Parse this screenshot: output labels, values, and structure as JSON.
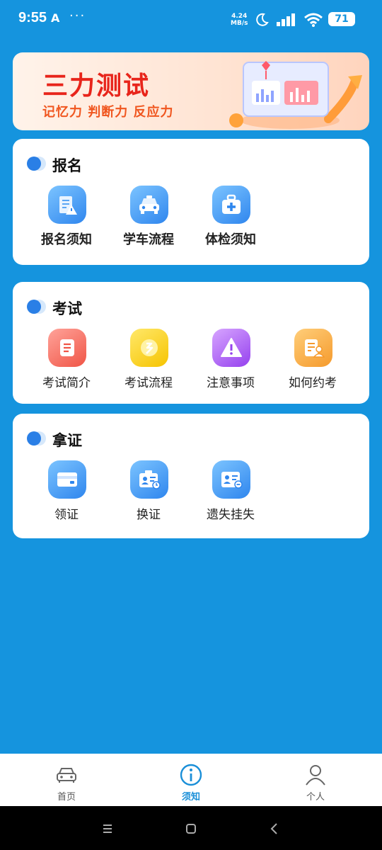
{
  "status_bar": {
    "time": "9:55",
    "app_indicator": "A",
    "more": "···",
    "speed_value": "4.24",
    "speed_unit": "MB/s",
    "battery": "71"
  },
  "banner": {
    "title": "三力测试",
    "subtitle": "记忆力 判断力 反应力"
  },
  "sections": {
    "signup": {
      "title": "报名",
      "items": [
        {
          "label": "报名须知",
          "icon": "document-warning-icon"
        },
        {
          "label": "学车流程",
          "icon": "car-icon"
        },
        {
          "label": "体检须知",
          "icon": "medical-kit-icon"
        }
      ]
    },
    "exam": {
      "title": "考试",
      "items": [
        {
          "label": "考试简介",
          "icon": "document-icon"
        },
        {
          "label": "考试流程",
          "icon": "flow-icon"
        },
        {
          "label": "注意事项",
          "icon": "warning-icon"
        },
        {
          "label": "如何约考",
          "icon": "appointment-icon"
        }
      ]
    },
    "license": {
      "title": "拿证",
      "items": [
        {
          "label": "领证",
          "icon": "card-icon"
        },
        {
          "label": "换证",
          "icon": "id-renew-icon"
        },
        {
          "label": "遗失挂失",
          "icon": "id-lost-icon"
        }
      ]
    }
  },
  "bottom_nav": {
    "items": [
      {
        "label": "首页",
        "icon": "car-outline-icon",
        "active": false
      },
      {
        "label": "须知",
        "icon": "info-icon",
        "active": true
      },
      {
        "label": "个人",
        "icon": "person-icon",
        "active": false
      }
    ]
  },
  "colors": {
    "background": "#1594de",
    "accent": "#1a8fd8",
    "banner_title": "#e8251b"
  }
}
